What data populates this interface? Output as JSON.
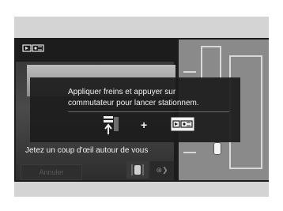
{
  "overlay": {
    "message_line1": "Appliquer freins et appuyer sur",
    "message_line2": "commutateur pour lancer stationnem.",
    "plus": "+"
  },
  "bottom": {
    "glance_text": "Jetez un coup d'œil autour de vous",
    "cancel_label": "Annuler",
    "next_label": "⊛❯"
  },
  "icons": {
    "mode": "parking-sensor-icon",
    "brake": "brake-pedal-icon",
    "park_switch": "parking-pilot-switch-icon",
    "view": "car-view-icon"
  },
  "colors": {
    "background": "#d4d4d4",
    "screen": "#1c1c1c",
    "text": "#f2f2f2"
  }
}
